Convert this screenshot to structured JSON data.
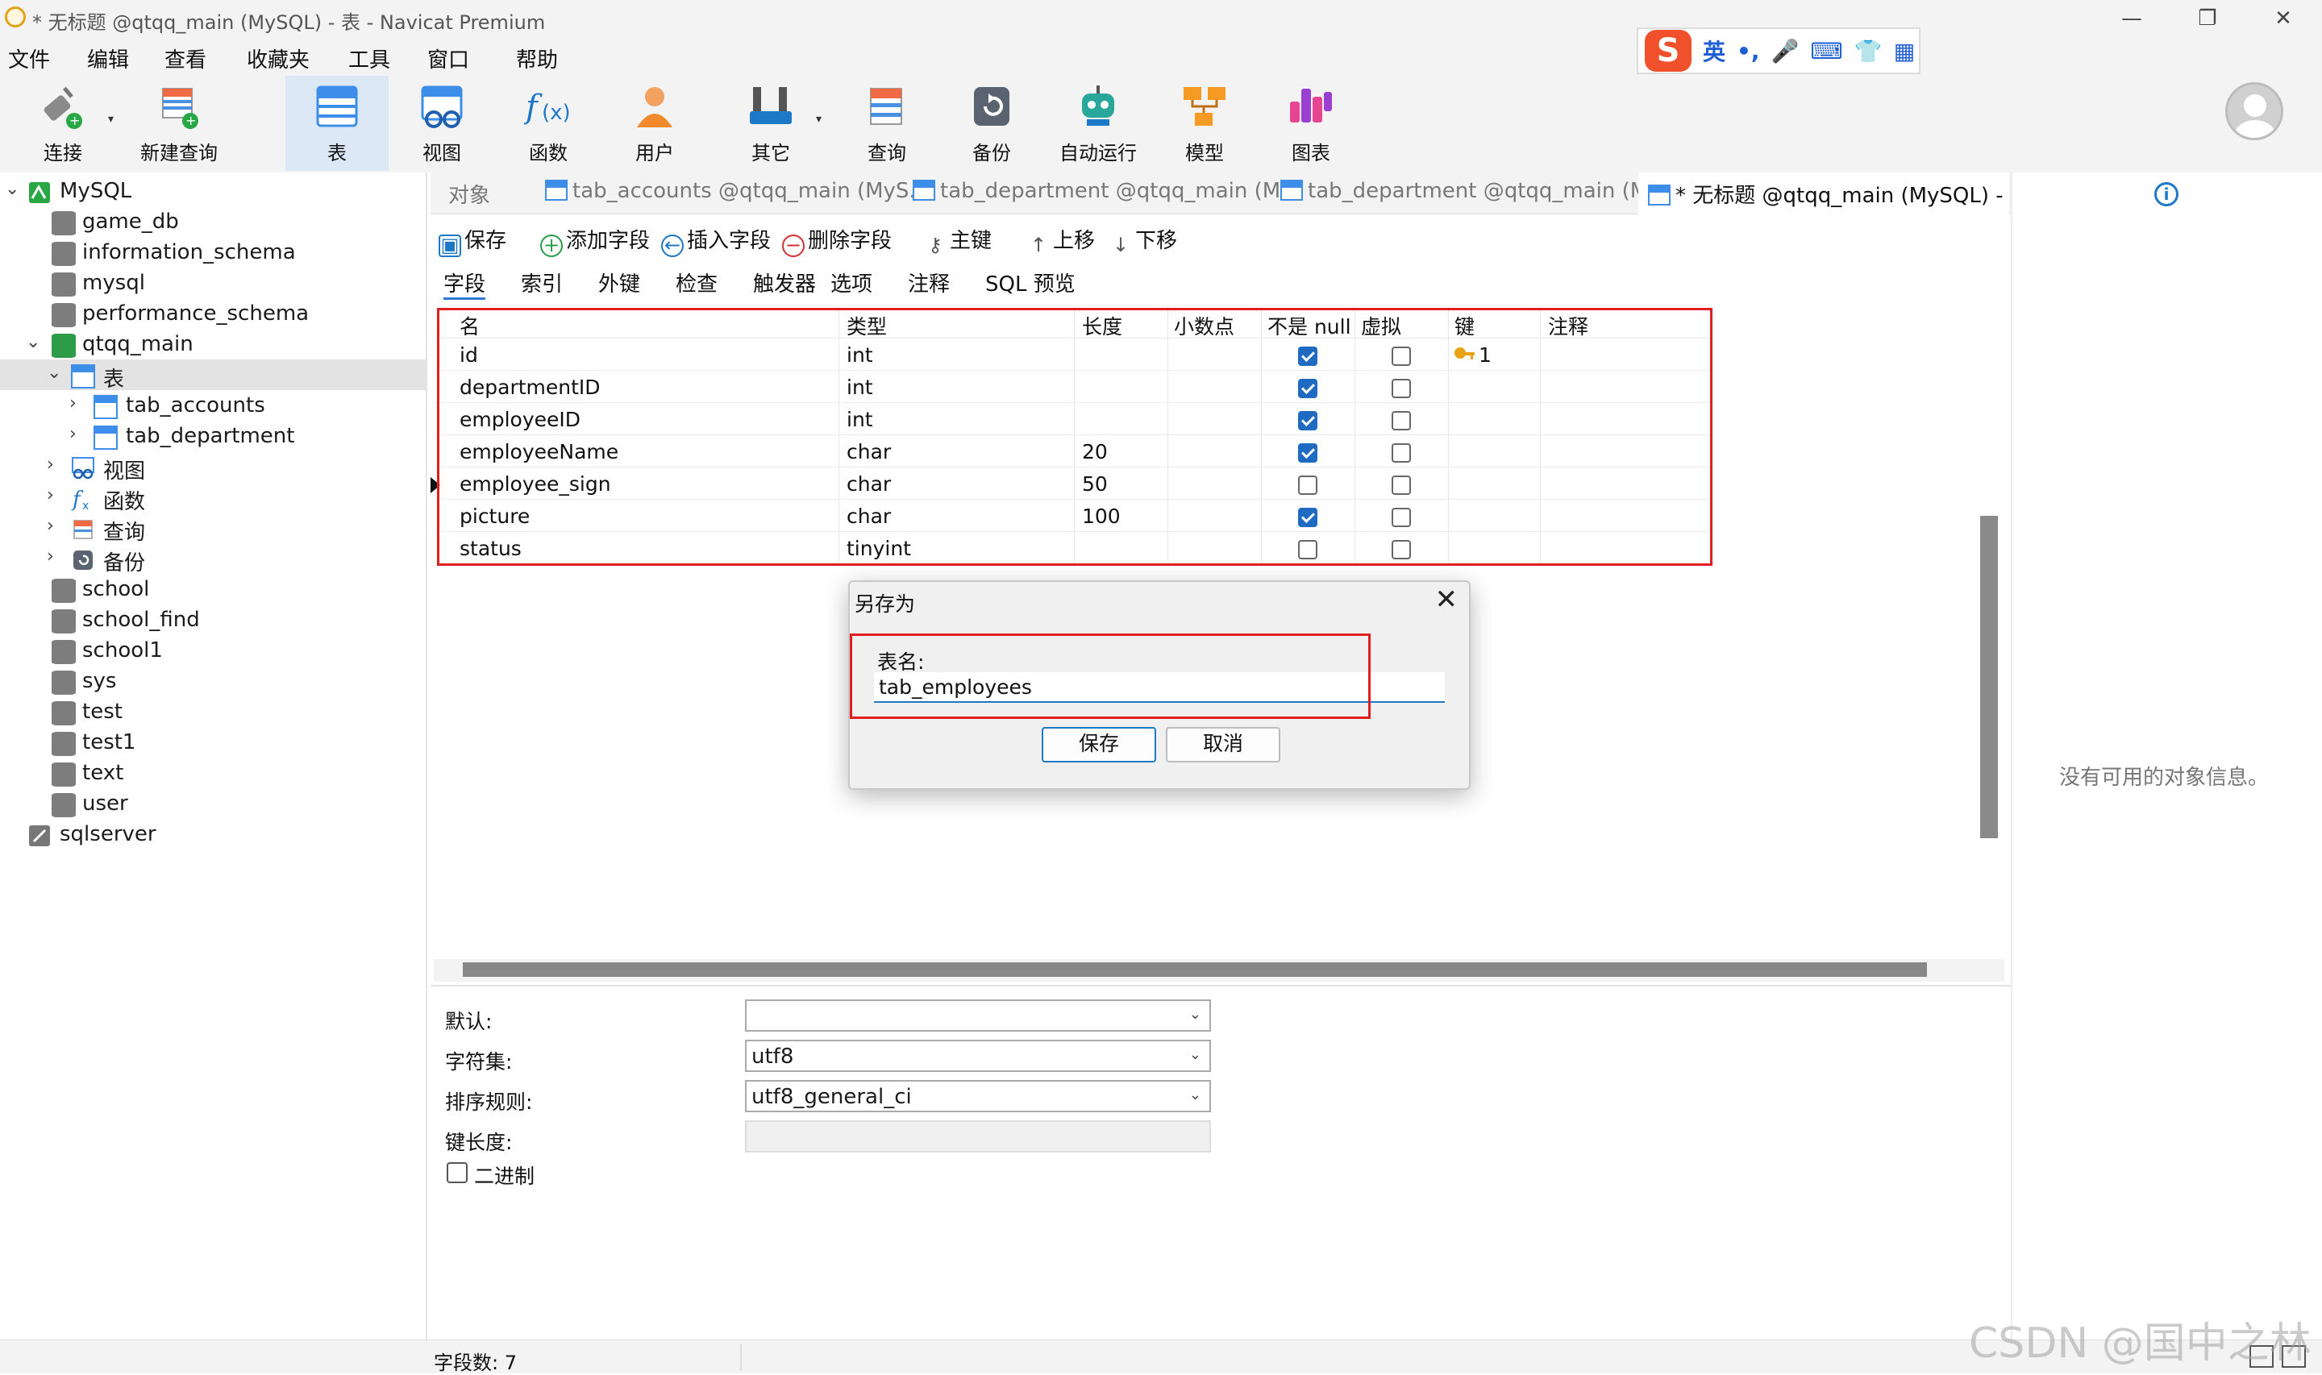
{
  "window": {
    "title": "* 无标题 @qtqq_main (MySQL) - 表 - Navicat Premium"
  },
  "menu": [
    "文件",
    "编辑",
    "查看",
    "收藏夹",
    "工具",
    "窗口",
    "帮助"
  ],
  "ime": {
    "lang": "英"
  },
  "toolbar": [
    {
      "label": "连接",
      "icon": "plug-icon"
    },
    {
      "label": "新建查询",
      "icon": "new-query-icon"
    },
    {
      "label": "表",
      "icon": "table-icon",
      "selected": true
    },
    {
      "label": "视图",
      "icon": "view-icon"
    },
    {
      "label": "函数",
      "icon": "function-icon"
    },
    {
      "label": "用户",
      "icon": "user-icon"
    },
    {
      "label": "其它",
      "icon": "tools-icon"
    },
    {
      "label": "查询",
      "icon": "query-icon"
    },
    {
      "label": "备份",
      "icon": "backup-icon"
    },
    {
      "label": "自动运行",
      "icon": "robot-icon"
    },
    {
      "label": "模型",
      "icon": "model-icon"
    },
    {
      "label": "图表",
      "icon": "chart-icon"
    }
  ],
  "navigator": {
    "items": [
      "MySQL",
      "game_db",
      "information_schema",
      "mysql",
      "performance_schema",
      "qtqq_main",
      "表",
      "tab_accounts",
      "tab_department",
      "视图",
      "函数",
      "查询",
      "备份",
      "school",
      "school_find",
      "school1",
      "sys",
      "test",
      "test1",
      "text",
      "user",
      "sqlserver"
    ]
  },
  "tabs": [
    "对象",
    "tab_accounts @qtqq_main (MyS...",
    "tab_department @qtqq_main (M...",
    "tab_department @qtqq_main (M...",
    "* 无标题 @qtqq_main (MySQL) - 表"
  ],
  "editor_toolbar": {
    "save": "保存",
    "add_field": "添加字段",
    "insert_field": "插入字段",
    "delete_field": "删除字段",
    "primary_key": "主键",
    "move_up": "上移",
    "move_down": "下移"
  },
  "subtabs": [
    "字段",
    "索引",
    "外键",
    "检查",
    "触发器",
    "选项",
    "注释",
    "SQL 预览"
  ],
  "grid": {
    "columns": [
      "名",
      "类型",
      "长度",
      "小数点",
      "不是 null",
      "虚拟",
      "键",
      "注释"
    ],
    "rows": [
      {
        "name": "id",
        "type": "int",
        "length": "",
        "notnull": true,
        "virtual": false,
        "key": "1"
      },
      {
        "name": "departmentID",
        "type": "int",
        "length": "",
        "notnull": true,
        "virtual": false,
        "key": ""
      },
      {
        "name": "employeeID",
        "type": "int",
        "length": "",
        "notnull": true,
        "virtual": false,
        "key": ""
      },
      {
        "name": "employeeName",
        "type": "char",
        "length": "20",
        "notnull": true,
        "virtual": false,
        "key": ""
      },
      {
        "name": "employee_sign",
        "type": "char",
        "length": "50",
        "notnull": false,
        "virtual": false,
        "key": ""
      },
      {
        "name": "picture",
        "type": "char",
        "length": "100",
        "notnull": true,
        "virtual": false,
        "key": ""
      },
      {
        "name": "status",
        "type": "tinyint",
        "length": "",
        "notnull": false,
        "virtual": false,
        "key": ""
      }
    ]
  },
  "properties": {
    "default_label": "默认:",
    "default_value": "",
    "charset_label": "字符集:",
    "charset_value": "utf8",
    "collation_label": "排序规则:",
    "collation_value": "utf8_general_ci",
    "keylen_label": "键长度:",
    "binary_label": "二进制"
  },
  "info_panel": {
    "message": "没有可用的对象信息。"
  },
  "status": {
    "field_count": "字段数: 7"
  },
  "dialog": {
    "title": "另存为",
    "label": "表名:",
    "value": "tab_employees",
    "save": "保存",
    "cancel": "取消"
  },
  "watermark": "CSDN @国中之林"
}
